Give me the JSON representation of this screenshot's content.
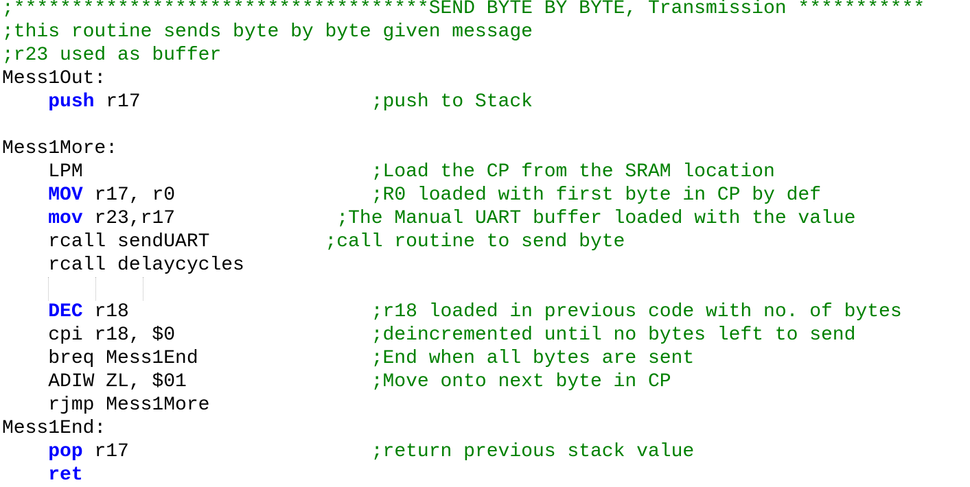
{
  "colors": {
    "background": "#ffffff",
    "text": "#000000",
    "keyword": "#0000ff",
    "comment": "#008000",
    "indent_guide": "#b8b8b8"
  },
  "editor": {
    "language": "AVR assembly",
    "lines": [
      {
        "tokens": [
          {
            "kind": "comment",
            "text": ";************************************SEND BYTE BY BYTE, Transmission ***********"
          }
        ]
      },
      {
        "tokens": [
          {
            "kind": "comment",
            "text": ";this routine sends byte by byte given message"
          }
        ]
      },
      {
        "tokens": [
          {
            "kind": "comment",
            "text": ";r23 used as buffer"
          }
        ]
      },
      {
        "tokens": [
          {
            "kind": "plain",
            "text": "Mess1Out:"
          }
        ]
      },
      {
        "tokens": [
          {
            "kind": "plain",
            "text": "    "
          },
          {
            "kind": "keyword",
            "text": "push"
          },
          {
            "kind": "plain",
            "text": " r17                    "
          },
          {
            "kind": "comment",
            "text": ";push to Stack"
          }
        ]
      },
      {
        "tokens": []
      },
      {
        "tokens": [
          {
            "kind": "plain",
            "text": "Mess1More:"
          }
        ]
      },
      {
        "tokens": [
          {
            "kind": "plain",
            "text": "    LPM                         "
          },
          {
            "kind": "comment",
            "text": ";Load the CP from the SRAM location"
          }
        ]
      },
      {
        "tokens": [
          {
            "kind": "plain",
            "text": "    "
          },
          {
            "kind": "keyword",
            "text": "MOV"
          },
          {
            "kind": "plain",
            "text": " r17, r0                 "
          },
          {
            "kind": "comment",
            "text": ";R0 loaded with first byte in CP by def"
          }
        ]
      },
      {
        "tokens": [
          {
            "kind": "plain",
            "text": "    "
          },
          {
            "kind": "keyword",
            "text": "mov"
          },
          {
            "kind": "plain",
            "text": " r23,r17              "
          },
          {
            "kind": "comment",
            "text": ";The Manual UART buffer loaded with the value"
          }
        ]
      },
      {
        "tokens": [
          {
            "kind": "plain",
            "text": "    rcall sendUART          "
          },
          {
            "kind": "comment",
            "text": ";call routine to send byte"
          }
        ]
      },
      {
        "tokens": [
          {
            "kind": "plain",
            "text": "    rcall delaycycles"
          }
        ]
      },
      {
        "tokens": [],
        "indent_guides": 3
      },
      {
        "tokens": [
          {
            "kind": "plain",
            "text": "    "
          },
          {
            "kind": "keyword",
            "text": "DEC"
          },
          {
            "kind": "plain",
            "text": " r18                     "
          },
          {
            "kind": "comment",
            "text": ";r18 loaded in previous code with no. of bytes"
          }
        ]
      },
      {
        "tokens": [
          {
            "kind": "plain",
            "text": "    cpi r18, $0                 "
          },
          {
            "kind": "comment",
            "text": ";deincremented until no bytes left to send"
          }
        ]
      },
      {
        "tokens": [
          {
            "kind": "plain",
            "text": "    breq Mess1End               "
          },
          {
            "kind": "comment",
            "text": ";End when all bytes are sent"
          }
        ]
      },
      {
        "tokens": [
          {
            "kind": "plain",
            "text": "    ADIW ZL, $01                "
          },
          {
            "kind": "comment",
            "text": ";Move onto next byte in CP"
          }
        ]
      },
      {
        "tokens": [
          {
            "kind": "plain",
            "text": "    rjmp Mess1More"
          }
        ]
      },
      {
        "tokens": [
          {
            "kind": "plain",
            "text": "Mess1End:"
          }
        ]
      },
      {
        "tokens": [
          {
            "kind": "plain",
            "text": "    "
          },
          {
            "kind": "keyword",
            "text": "pop"
          },
          {
            "kind": "plain",
            "text": " r17                     "
          },
          {
            "kind": "comment",
            "text": ";return previous stack value"
          }
        ]
      },
      {
        "tokens": [
          {
            "kind": "plain",
            "text": "    "
          },
          {
            "kind": "keyword",
            "text": "ret"
          }
        ]
      }
    ]
  }
}
